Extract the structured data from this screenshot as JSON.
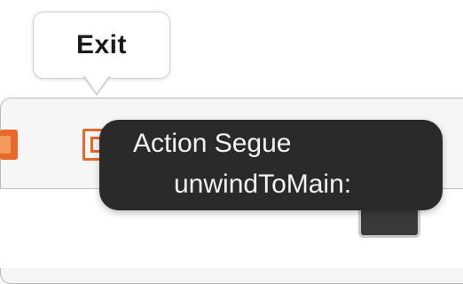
{
  "exit_callout": {
    "label": "Exit"
  },
  "segue_tooltip": {
    "title": "Action Segue",
    "action": "unwindToMain:"
  },
  "colors": {
    "accent": "#e8672a",
    "tooltip_bg": "#2a2a2a",
    "tooltip_text": "#f2f2f2"
  },
  "icons": {
    "dock_left": "view-controller-icon",
    "exit": "exit-icon"
  }
}
